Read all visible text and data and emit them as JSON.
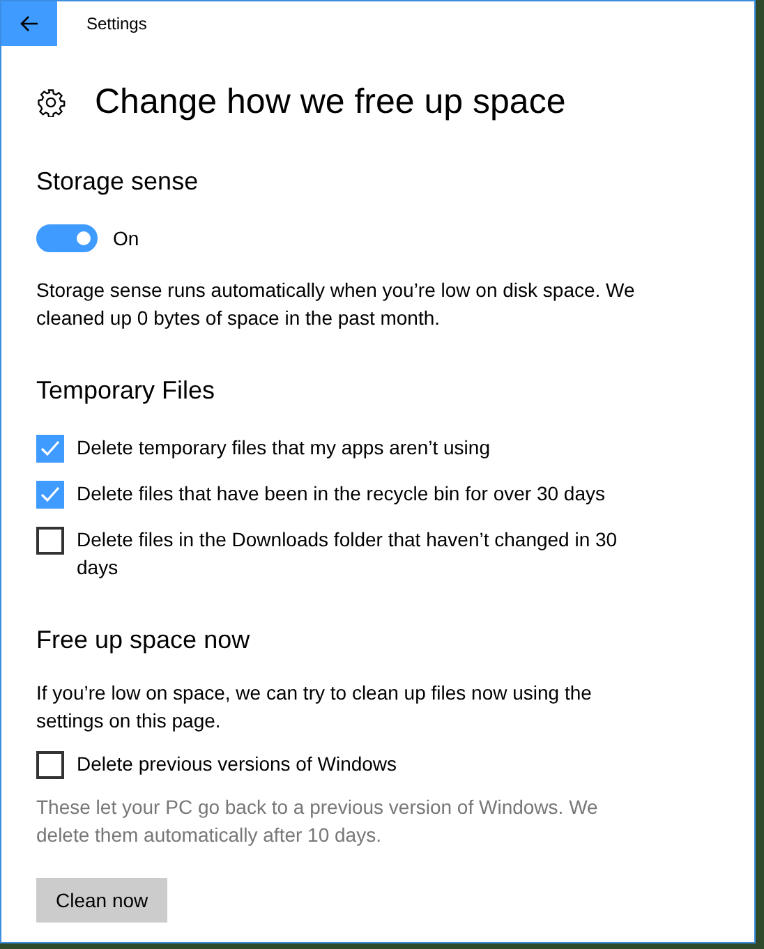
{
  "window": {
    "title": "Settings"
  },
  "page": {
    "title": "Change how we free up space"
  },
  "storage_sense": {
    "heading": "Storage sense",
    "toggle": {
      "on": true,
      "label": "On"
    },
    "description": "Storage sense runs automatically when you’re low on disk space. We cleaned up 0 bytes of space in the past month."
  },
  "temporary_files": {
    "heading": "Temporary Files",
    "options": [
      {
        "label": "Delete temporary files that my apps aren’t using",
        "checked": true
      },
      {
        "label": "Delete files that have been in the recycle bin for over 30 days",
        "checked": true
      },
      {
        "label": "Delete files in the Downloads folder that haven’t changed in 30 days",
        "checked": false
      }
    ]
  },
  "free_up_space_now": {
    "heading": "Free up space now",
    "description": "If you’re low on space, we can try to clean up files now using the settings on this page.",
    "options": [
      {
        "label": "Delete previous versions of Windows",
        "checked": false
      }
    ],
    "note": "These let your PC go back to a previous version of Windows. We delete them automatically after 10 days.",
    "button": "Clean now"
  }
}
